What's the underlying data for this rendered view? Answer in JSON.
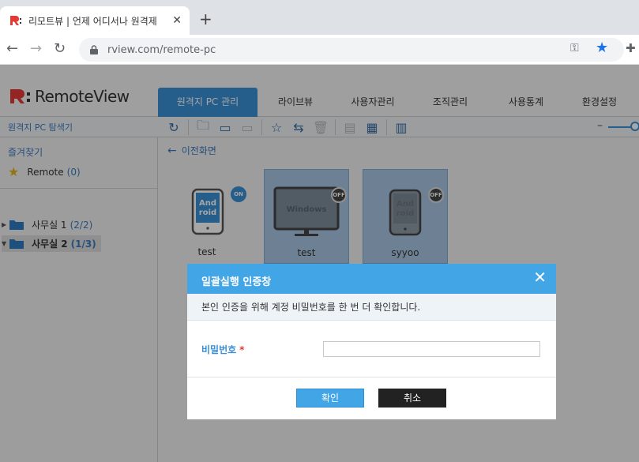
{
  "browser": {
    "tab_title": "리모트뷰 | 언제 어디서나 원격제",
    "tab_close": "✕",
    "new_tab": "+",
    "url": "rview.com/remote-pc"
  },
  "app": {
    "logo_text": "RemoteView",
    "menu": [
      {
        "label": "원격지 PC 관리",
        "active": true
      },
      {
        "label": "라이브뷰"
      },
      {
        "label": "사용자관리"
      },
      {
        "label": "조직관리"
      },
      {
        "label": "사용통계"
      },
      {
        "label": "환경설정"
      }
    ],
    "sidebar_title": "원격지 PC 탐색기"
  },
  "sidebar": {
    "favorites_title": "즐겨찾기",
    "favorite_item": {
      "label": "Remote",
      "count": "(0)"
    },
    "groups": [
      {
        "label": "사무실 1",
        "count": "(2/2)",
        "selected": false
      },
      {
        "label": "사무실 2",
        "count": "(1/3)",
        "selected": true
      }
    ]
  },
  "main": {
    "back_label": "이전화면",
    "devices": [
      {
        "name": "test",
        "type": "Android",
        "status": "ON",
        "selected": false
      },
      {
        "name": "test",
        "type": "Windows",
        "status": "OFF",
        "selected": true
      },
      {
        "name": "syyoo",
        "type": "Android",
        "status": "OFF",
        "selected": true
      }
    ]
  },
  "dialog": {
    "title": "일괄실행 인증창",
    "close_icon": "✕",
    "description": "본인 인증을 위해 계정 비밀번호를 한 번 더 확인합니다.",
    "password_label": "비밀번호",
    "required_mark": "*",
    "password_value": "",
    "ok_label": "확인",
    "cancel_label": "취소"
  },
  "colors": {
    "accent": "#42a5e6",
    "menu_active": "#3a8fd6",
    "required": "#e53935"
  }
}
